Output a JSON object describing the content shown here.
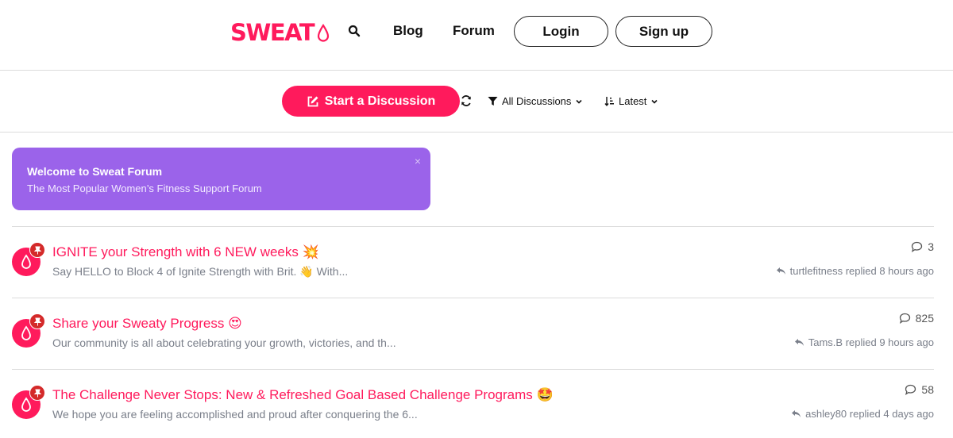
{
  "brand": {
    "logo_text": "SWEAT",
    "accent": "#ff1a5c"
  },
  "nav": {
    "blog": "Blog",
    "forum": "Forum",
    "login": "Login",
    "signup": "Sign up"
  },
  "toolbar": {
    "start_discussion": "Start a Discussion",
    "filter_label": "All Discussions",
    "sort_label": "Latest"
  },
  "welcome": {
    "title": "Welcome to Sweat Forum",
    "subtitle": "The Most Popular Women’s Fitness Support Forum",
    "close": "×",
    "color": "#9b63ea"
  },
  "discussions": [
    {
      "title": "IGNITE your Strength with 6 NEW weeks 💥",
      "excerpt": "Say HELLO to Block 4 of Ignite Strength with Brit. 👋 With...",
      "replies": "3",
      "meta": "turtlefitness replied 8 hours ago"
    },
    {
      "title": "Share your Sweaty Progress 😍",
      "excerpt": "Our community is all about celebrating your growth, victories, and th...",
      "replies": "825",
      "meta": "Tams.B replied 9 hours ago"
    },
    {
      "title": "The Challenge Never Stops: New & Refreshed Goal Based Challenge Programs 🤩",
      "excerpt": "We hope you are feeling accomplished and proud after conquering the 6...",
      "replies": "58",
      "meta": "ashley80 replied 4 days ago"
    }
  ]
}
